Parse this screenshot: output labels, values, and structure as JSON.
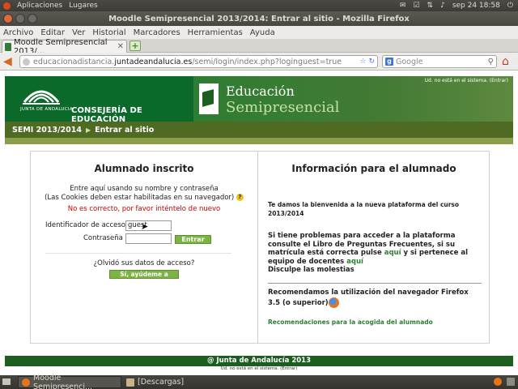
{
  "top_panel": {
    "applications": "Aplicaciones",
    "places": "Lugares",
    "clock": "sep 24 18:58"
  },
  "window": {
    "title": "Moodle Semipresencial 2013/2014: Entrar al sitio - Mozilla Firefox"
  },
  "menubar": [
    "Archivo",
    "Editar",
    "Ver",
    "Historial",
    "Marcadores",
    "Herramientas",
    "Ayuda"
  ],
  "tab": {
    "label": "Moodle Semipresencial 2013/...",
    "new_tab": "+"
  },
  "navbar": {
    "url_prefix": "educacionadistancia.",
    "url_domain": "juntadeandalucia.es",
    "url_suffix": "/semi/login/index.php?loginguest=true",
    "search_placeholder": "Google"
  },
  "header": {
    "junta_caption": "JUNTA DE ANDALUCIA",
    "consejeria": "CONSEJERÍA DE EDUCACIÓN",
    "title": "Educación",
    "subtitle": "Semipresencial",
    "login_status": "Ud. no está en el sistema. (Entrar)"
  },
  "breadcrumb": {
    "home": "SEMI 2013/2014",
    "separator": "▶",
    "current": "Entrar al sitio"
  },
  "login": {
    "heading": "Alumnado inscrito",
    "intro_line1": "Entre aquí usando su nombre y contraseña",
    "intro_line2": "(Las Cookies deben estar habilitadas en su navegador)",
    "error": "No es correcto, por favor inténtelo de nuevo",
    "username_label": "Identificador de acceso",
    "username_value": "guest",
    "password_label": "Contraseña",
    "submit_label": "Entrar",
    "forgot_text": "¿Olvidó sus datos de acceso?",
    "help_button": "Sí, ayúdeme a entrar"
  },
  "info": {
    "heading": "Información para el alumnado",
    "welcome": "Te damos la bienvenida a la nueva plataforma del curso 2013/2014",
    "problems_pre": "Si tiene problemas para acceder a la plataforma consulte el Libro de Preguntas Frecuentes, si su matrícula está correcta pulse ",
    "link1": "aquí",
    "problems_mid": " y si pertenece al equipo de docentes ",
    "link2": "aquí",
    "apologies": "Disculpe las molestias",
    "recommend": "Recomendamos la utilización del navegador Firefox 3.5 (o superior)",
    "recommendations_link": "Recomendaciones para la acogida del alumnado"
  },
  "footer": {
    "copyright": "@ Junta de Andalucía 2013",
    "login_status": "Ud. no está en el sistema. (Entrar)"
  },
  "taskbar": {
    "task1": "Moodle Semipresenci...",
    "task2": "[Descargas]"
  }
}
